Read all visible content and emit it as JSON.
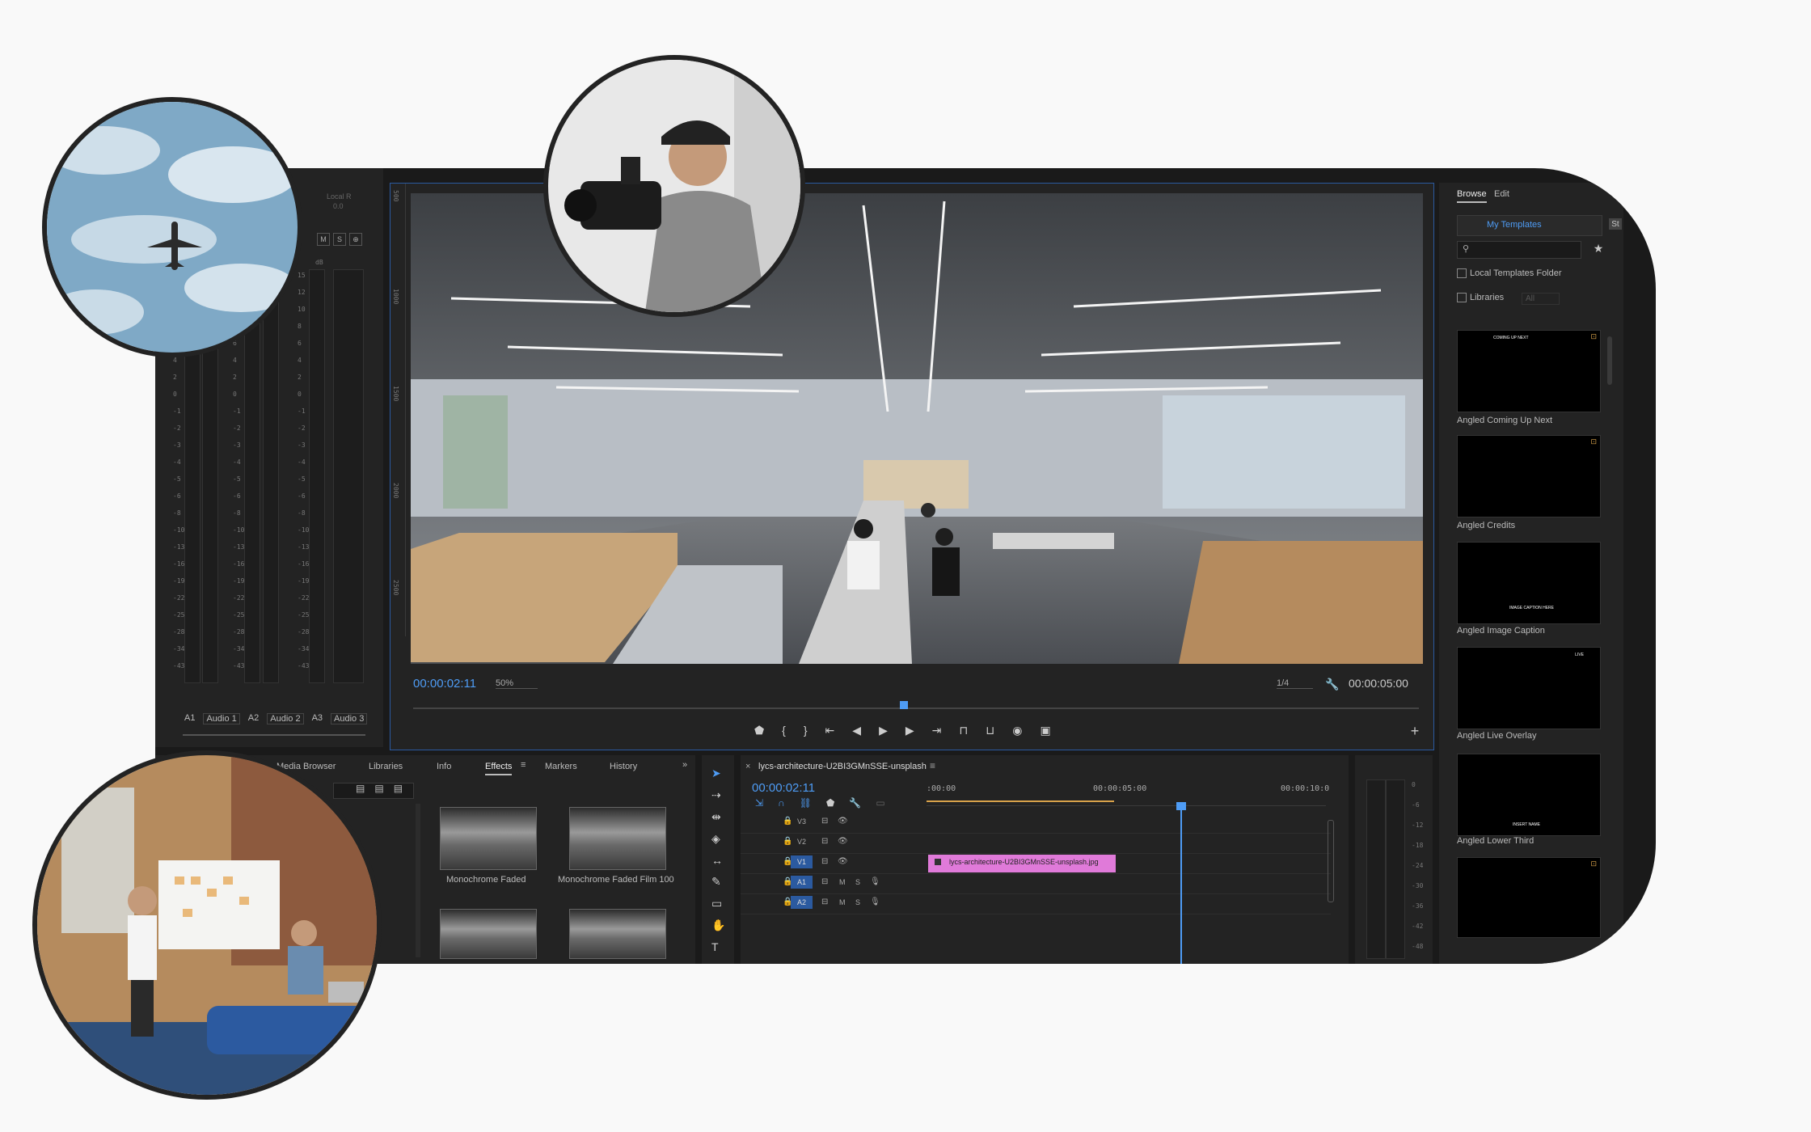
{
  "audio_mixer": {
    "track_labels": [
      {
        "id": "A1",
        "name": "Audio 1"
      },
      {
        "id": "A2",
        "name": "Audio 2"
      },
      {
        "id": "A3",
        "name": "Audio 3"
      }
    ],
    "top_label": "Local R",
    "top_value": "0.0",
    "msr_buttons": [
      "M",
      "S",
      "⊕"
    ],
    "db_unit": "dB",
    "db_scale": [
      "15",
      "12",
      "10",
      "8",
      "6",
      "4",
      "2",
      "0",
      "-1",
      "-2",
      "-3",
      "-4",
      "-5",
      "-6",
      "-8",
      "-10",
      "-13",
      "-16",
      "-19",
      "-22",
      "-25",
      "-28",
      "-34",
      "-43"
    ]
  },
  "program_monitor": {
    "current_time": "00:00:02:11",
    "zoom": "50%",
    "resolution": "1/4",
    "duration": "00:00:05:00",
    "ruler_labels": [
      "500",
      "1000",
      "1500",
      "2000",
      "2500"
    ]
  },
  "bottom_left_panel": {
    "tabs": [
      "Media Browser",
      "Libraries",
      "Info",
      "Effects",
      "Markers",
      "History"
    ],
    "active_tab": "Effects",
    "effects": [
      {
        "label": "Monochrome Faded"
      },
      {
        "label": "Monochrome Faded Film 100"
      }
    ]
  },
  "timeline": {
    "sequence_name": "lycs-architecture-U2BI3GMnSSE-unsplash",
    "current_time": "00:00:02:11",
    "ruler": [
      ":00:00",
      "00:00:05:00",
      "00:00:10:0"
    ],
    "tracks": [
      {
        "id": "V3",
        "type": "video"
      },
      {
        "id": "V2",
        "type": "video"
      },
      {
        "id": "V1",
        "type": "video"
      },
      {
        "id": "A1",
        "type": "audio"
      },
      {
        "id": "A2",
        "type": "audio"
      }
    ],
    "clip_name": "lycs-architecture-U2BI3GMnSSE-unsplash.jpg",
    "clip_color": "#e07ad9",
    "audio_meter_scale": [
      "0",
      "-6",
      "-12",
      "-18",
      "-24",
      "-30",
      "-36",
      "-42",
      "-48"
    ]
  },
  "essential_graphics": {
    "tabs": [
      "Browse",
      "Edit"
    ],
    "active_tab": "Browse",
    "dropdown": "My Templates",
    "checkbox_local": "Local Templates Folder",
    "checkbox_libraries": "Libraries",
    "libraries_select": "All",
    "templates": [
      {
        "label": "Angled Coming Up Next",
        "thumb_text": "COMING UP NEXT"
      },
      {
        "label": "Angled Credits",
        "thumb_text": ""
      },
      {
        "label": "Angled Image Caption",
        "thumb_text": "IMAGE CAPTION HERE"
      },
      {
        "label": "Angled Live Overlay",
        "thumb_text": "LIVE"
      },
      {
        "label": "Angled Lower Third",
        "thumb_text": "INSERT NAME"
      },
      {
        "label": "",
        "thumb_text": ""
      }
    ]
  },
  "colors": {
    "accent_blue": "#4e9cf5",
    "panel_bg": "#232323",
    "clip_pink": "#e07ad9"
  }
}
